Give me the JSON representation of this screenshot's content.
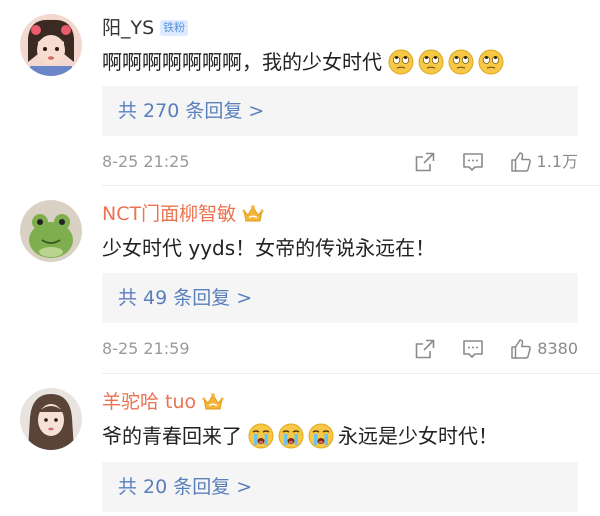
{
  "comments": [
    {
      "username": "阳_YS",
      "badge": "铁粉",
      "text": "啊啊啊啊啊啊啊，我的少女时代",
      "emoji_icons": [
        "rolling-eyes-emoji",
        "rolling-eyes-emoji",
        "rolling-eyes-emoji",
        "rolling-eyes-emoji"
      ],
      "replies_label": "共 270 条回复 >",
      "date": "8-25 21:25",
      "likes": "1.1万"
    },
    {
      "username": "NCT门面柳智敏",
      "crown_icon": "member-crown-icon",
      "text": "少女时代 yyds！女帝的传说永远在！",
      "replies_label": "共 49 条回复 >",
      "date": "8-25 21:59",
      "likes": "8380"
    },
    {
      "username": "羊驼哈 tuo",
      "crown_icon": "member-crown-icon",
      "text_before": "爷的青春回来了",
      "emoji_icons": [
        "crying-emoji",
        "crying-emoji",
        "crying-emoji"
      ],
      "text_after": "永远是少女时代！",
      "replies_label": "共 20 条回复 >"
    }
  ],
  "colors": {
    "username_member": "#eb7350",
    "link_blue": "#5a7fbd",
    "meta_gray": "#9a9a9a",
    "reply_bg": "#f5f5f5"
  }
}
